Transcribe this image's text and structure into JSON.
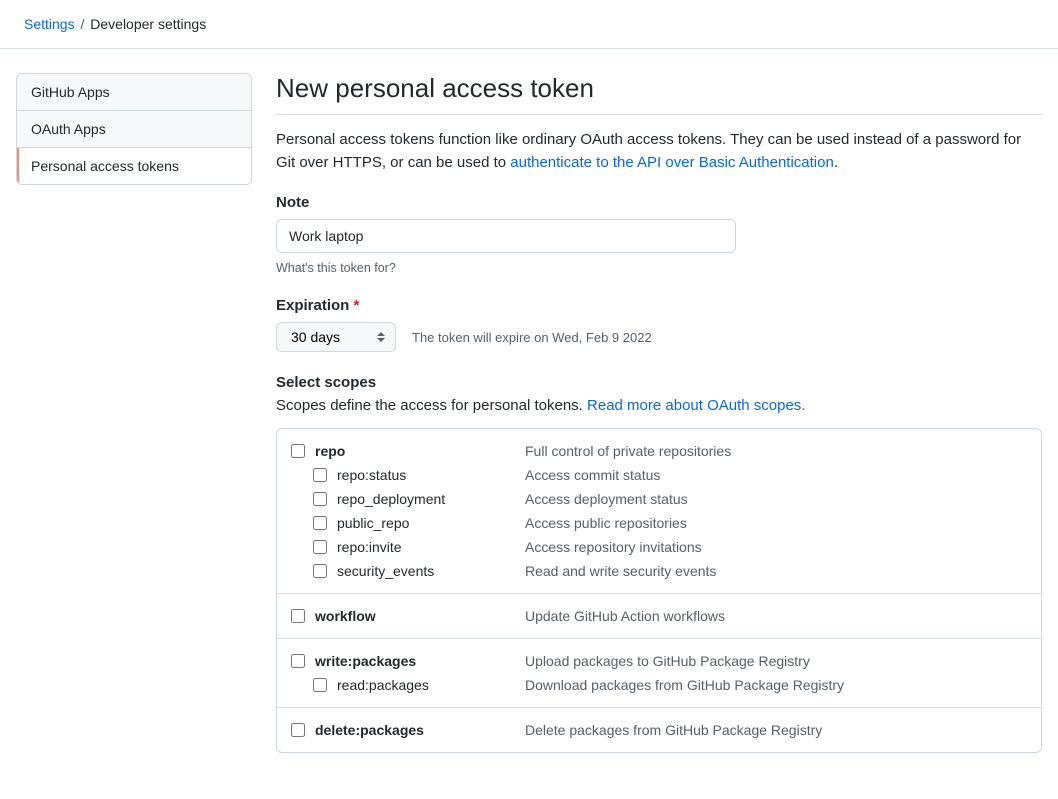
{
  "breadcrumb": {
    "root": "Settings",
    "current": "Developer settings"
  },
  "sidebar": {
    "items": [
      {
        "label": "GitHub Apps"
      },
      {
        "label": "OAuth Apps"
      },
      {
        "label": "Personal access tokens"
      }
    ]
  },
  "page": {
    "title": "New personal access token",
    "description_pre": "Personal access tokens function like ordinary OAuth access tokens. They can be used instead of a password for Git over HTTPS, or can be used to ",
    "description_link": "authenticate to the API over Basic Authentication",
    "note_label": "Note",
    "note_value": "Work laptop",
    "note_helper": "What's this token for?",
    "expiration_label": "Expiration",
    "expiration_value": "30 days",
    "expiration_note": "The token will expire on Wed, Feb 9 2022",
    "scopes_heading": "Select scopes",
    "scopes_desc_pre": "Scopes define the access for personal tokens. ",
    "scopes_desc_link": "Read more about OAuth scopes."
  },
  "scopes": [
    {
      "name": "repo",
      "desc": "Full control of private repositories",
      "children": [
        {
          "name": "repo:status",
          "desc": "Access commit status"
        },
        {
          "name": "repo_deployment",
          "desc": "Access deployment status"
        },
        {
          "name": "public_repo",
          "desc": "Access public repositories"
        },
        {
          "name": "repo:invite",
          "desc": "Access repository invitations"
        },
        {
          "name": "security_events",
          "desc": "Read and write security events"
        }
      ]
    },
    {
      "name": "workflow",
      "desc": "Update GitHub Action workflows",
      "children": []
    },
    {
      "name": "write:packages",
      "desc": "Upload packages to GitHub Package Registry",
      "children": [
        {
          "name": "read:packages",
          "desc": "Download packages from GitHub Package Registry"
        }
      ]
    },
    {
      "name": "delete:packages",
      "desc": "Delete packages from GitHub Package Registry",
      "children": []
    }
  ]
}
